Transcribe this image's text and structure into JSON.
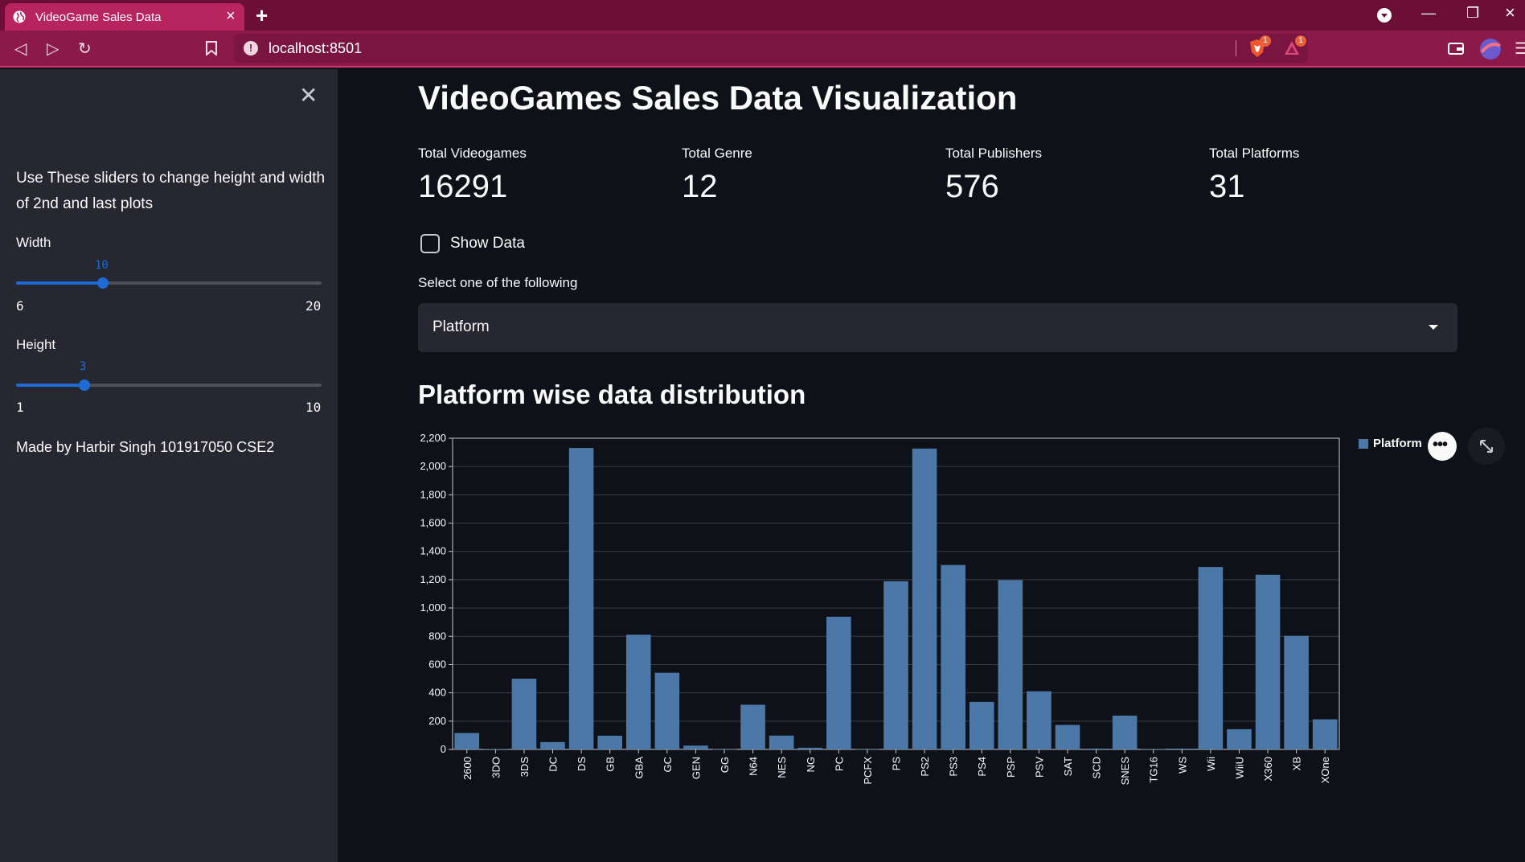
{
  "browser": {
    "tab_title": "VideoGame Sales Data",
    "url": "localhost:8501",
    "shield_badge": "1",
    "alert_badge": "1"
  },
  "sidebar": {
    "intro": "Use These sliders to change height and width of 2nd and last plots",
    "width_slider": {
      "label": "Width",
      "value": "10",
      "min": "6",
      "max": "20"
    },
    "height_slider": {
      "label": "Height",
      "value": "3",
      "min": "1",
      "max": "10"
    },
    "credit": "Made by Harbir Singh 101917050 CSE2"
  },
  "main": {
    "title": "VideoGames Sales Data Visualization",
    "metrics": [
      {
        "label": "Total Videogames",
        "value": "16291"
      },
      {
        "label": "Total Genre",
        "value": "12"
      },
      {
        "label": "Total Publishers",
        "value": "576"
      },
      {
        "label": "Total Platforms",
        "value": "31"
      }
    ],
    "show_data_label": "Show Data",
    "select_label": "Select one of the following",
    "select_value": "Platform",
    "chart_heading": "Platform wise data distribution"
  },
  "chart_data": {
    "type": "bar",
    "legend": [
      "Platform"
    ],
    "bar_color": "#4c78a8",
    "ylim": [
      0,
      2200
    ],
    "yticks": [
      "0",
      "200",
      "400",
      "600",
      "800",
      "1,000",
      "1,200",
      "1,400",
      "1,600",
      "1,800",
      "2,000",
      "2,200"
    ],
    "categories": [
      "2600",
      "3DO",
      "3DS",
      "DC",
      "DS",
      "GB",
      "GBA",
      "GC",
      "GEN",
      "GG",
      "N64",
      "NES",
      "NG",
      "PC",
      "PCFX",
      "PS",
      "PS2",
      "PS3",
      "PS4",
      "PSP",
      "PSV",
      "SAT",
      "SCD",
      "SNES",
      "TG16",
      "WS",
      "Wii",
      "WiiU",
      "X360",
      "XB",
      "XOne"
    ],
    "values": [
      116,
      3,
      500,
      52,
      2131,
      97,
      811,
      542,
      27,
      1,
      316,
      98,
      12,
      938,
      1,
      1189,
      2127,
      1304,
      336,
      1197,
      411,
      173,
      6,
      239,
      2,
      6,
      1290,
      143,
      1235,
      803,
      213
    ]
  }
}
